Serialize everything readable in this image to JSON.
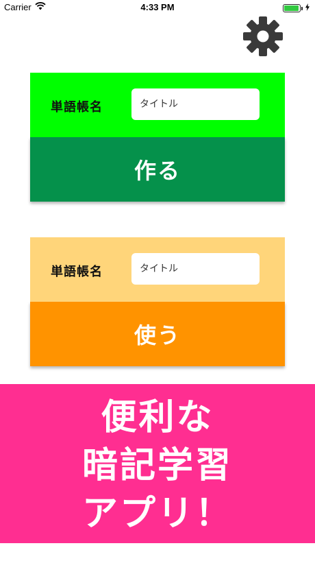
{
  "status_bar": {
    "carrier": "Carrier",
    "time": "4:33 PM",
    "battery_level": 0.95
  },
  "settings": {
    "icon": "gear-icon"
  },
  "create_card": {
    "label": "単語帳名",
    "placeholder": "タイトル",
    "value": "",
    "button_label": "作る"
  },
  "use_card": {
    "label": "単語帳名",
    "placeholder": "タイトル",
    "value": "",
    "button_label": "使う"
  },
  "banner": {
    "lines": [
      "便利な",
      "暗記学習",
      "アプリ！"
    ]
  },
  "colors": {
    "create_header": "#00ff00",
    "create_button": "#05914b",
    "use_header": "#ffd57a",
    "use_button": "#ff9300",
    "banner": "#ff2e91",
    "battery": "#31c940"
  }
}
